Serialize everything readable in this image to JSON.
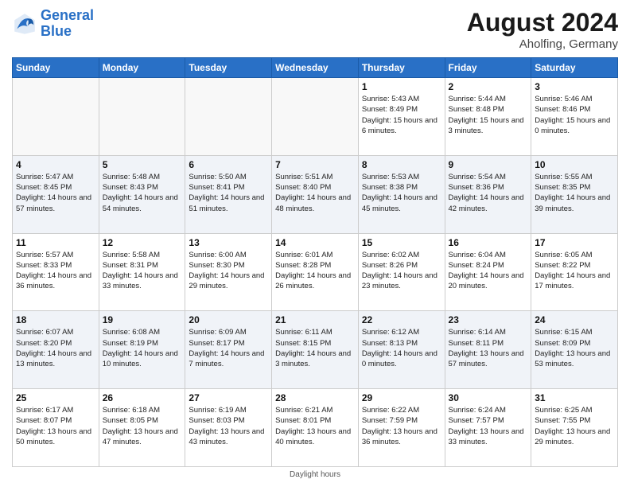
{
  "header": {
    "logo_line1": "General",
    "logo_line2": "Blue",
    "month_year": "August 2024",
    "location": "Aholfing, Germany"
  },
  "footer": {
    "note": "Daylight hours"
  },
  "days_of_week": [
    "Sunday",
    "Monday",
    "Tuesday",
    "Wednesday",
    "Thursday",
    "Friday",
    "Saturday"
  ],
  "weeks": [
    [
      {
        "day": "",
        "sunrise": "",
        "sunset": "",
        "daylight": ""
      },
      {
        "day": "",
        "sunrise": "",
        "sunset": "",
        "daylight": ""
      },
      {
        "day": "",
        "sunrise": "",
        "sunset": "",
        "daylight": ""
      },
      {
        "day": "",
        "sunrise": "",
        "sunset": "",
        "daylight": ""
      },
      {
        "day": "1",
        "sunrise": "Sunrise: 5:43 AM",
        "sunset": "Sunset: 8:49 PM",
        "daylight": "Daylight: 15 hours and 6 minutes."
      },
      {
        "day": "2",
        "sunrise": "Sunrise: 5:44 AM",
        "sunset": "Sunset: 8:48 PM",
        "daylight": "Daylight: 15 hours and 3 minutes."
      },
      {
        "day": "3",
        "sunrise": "Sunrise: 5:46 AM",
        "sunset": "Sunset: 8:46 PM",
        "daylight": "Daylight: 15 hours and 0 minutes."
      }
    ],
    [
      {
        "day": "4",
        "sunrise": "Sunrise: 5:47 AM",
        "sunset": "Sunset: 8:45 PM",
        "daylight": "Daylight: 14 hours and 57 minutes."
      },
      {
        "day": "5",
        "sunrise": "Sunrise: 5:48 AM",
        "sunset": "Sunset: 8:43 PM",
        "daylight": "Daylight: 14 hours and 54 minutes."
      },
      {
        "day": "6",
        "sunrise": "Sunrise: 5:50 AM",
        "sunset": "Sunset: 8:41 PM",
        "daylight": "Daylight: 14 hours and 51 minutes."
      },
      {
        "day": "7",
        "sunrise": "Sunrise: 5:51 AM",
        "sunset": "Sunset: 8:40 PM",
        "daylight": "Daylight: 14 hours and 48 minutes."
      },
      {
        "day": "8",
        "sunrise": "Sunrise: 5:53 AM",
        "sunset": "Sunset: 8:38 PM",
        "daylight": "Daylight: 14 hours and 45 minutes."
      },
      {
        "day": "9",
        "sunrise": "Sunrise: 5:54 AM",
        "sunset": "Sunset: 8:36 PM",
        "daylight": "Daylight: 14 hours and 42 minutes."
      },
      {
        "day": "10",
        "sunrise": "Sunrise: 5:55 AM",
        "sunset": "Sunset: 8:35 PM",
        "daylight": "Daylight: 14 hours and 39 minutes."
      }
    ],
    [
      {
        "day": "11",
        "sunrise": "Sunrise: 5:57 AM",
        "sunset": "Sunset: 8:33 PM",
        "daylight": "Daylight: 14 hours and 36 minutes."
      },
      {
        "day": "12",
        "sunrise": "Sunrise: 5:58 AM",
        "sunset": "Sunset: 8:31 PM",
        "daylight": "Daylight: 14 hours and 33 minutes."
      },
      {
        "day": "13",
        "sunrise": "Sunrise: 6:00 AM",
        "sunset": "Sunset: 8:30 PM",
        "daylight": "Daylight: 14 hours and 29 minutes."
      },
      {
        "day": "14",
        "sunrise": "Sunrise: 6:01 AM",
        "sunset": "Sunset: 8:28 PM",
        "daylight": "Daylight: 14 hours and 26 minutes."
      },
      {
        "day": "15",
        "sunrise": "Sunrise: 6:02 AM",
        "sunset": "Sunset: 8:26 PM",
        "daylight": "Daylight: 14 hours and 23 minutes."
      },
      {
        "day": "16",
        "sunrise": "Sunrise: 6:04 AM",
        "sunset": "Sunset: 8:24 PM",
        "daylight": "Daylight: 14 hours and 20 minutes."
      },
      {
        "day": "17",
        "sunrise": "Sunrise: 6:05 AM",
        "sunset": "Sunset: 8:22 PM",
        "daylight": "Daylight: 14 hours and 17 minutes."
      }
    ],
    [
      {
        "day": "18",
        "sunrise": "Sunrise: 6:07 AM",
        "sunset": "Sunset: 8:20 PM",
        "daylight": "Daylight: 14 hours and 13 minutes."
      },
      {
        "day": "19",
        "sunrise": "Sunrise: 6:08 AM",
        "sunset": "Sunset: 8:19 PM",
        "daylight": "Daylight: 14 hours and 10 minutes."
      },
      {
        "day": "20",
        "sunrise": "Sunrise: 6:09 AM",
        "sunset": "Sunset: 8:17 PM",
        "daylight": "Daylight: 14 hours and 7 minutes."
      },
      {
        "day": "21",
        "sunrise": "Sunrise: 6:11 AM",
        "sunset": "Sunset: 8:15 PM",
        "daylight": "Daylight: 14 hours and 3 minutes."
      },
      {
        "day": "22",
        "sunrise": "Sunrise: 6:12 AM",
        "sunset": "Sunset: 8:13 PM",
        "daylight": "Daylight: 14 hours and 0 minutes."
      },
      {
        "day": "23",
        "sunrise": "Sunrise: 6:14 AM",
        "sunset": "Sunset: 8:11 PM",
        "daylight": "Daylight: 13 hours and 57 minutes."
      },
      {
        "day": "24",
        "sunrise": "Sunrise: 6:15 AM",
        "sunset": "Sunset: 8:09 PM",
        "daylight": "Daylight: 13 hours and 53 minutes."
      }
    ],
    [
      {
        "day": "25",
        "sunrise": "Sunrise: 6:17 AM",
        "sunset": "Sunset: 8:07 PM",
        "daylight": "Daylight: 13 hours and 50 minutes."
      },
      {
        "day": "26",
        "sunrise": "Sunrise: 6:18 AM",
        "sunset": "Sunset: 8:05 PM",
        "daylight": "Daylight: 13 hours and 47 minutes."
      },
      {
        "day": "27",
        "sunrise": "Sunrise: 6:19 AM",
        "sunset": "Sunset: 8:03 PM",
        "daylight": "Daylight: 13 hours and 43 minutes."
      },
      {
        "day": "28",
        "sunrise": "Sunrise: 6:21 AM",
        "sunset": "Sunset: 8:01 PM",
        "daylight": "Daylight: 13 hours and 40 minutes."
      },
      {
        "day": "29",
        "sunrise": "Sunrise: 6:22 AM",
        "sunset": "Sunset: 7:59 PM",
        "daylight": "Daylight: 13 hours and 36 minutes."
      },
      {
        "day": "30",
        "sunrise": "Sunrise: 6:24 AM",
        "sunset": "Sunset: 7:57 PM",
        "daylight": "Daylight: 13 hours and 33 minutes."
      },
      {
        "day": "31",
        "sunrise": "Sunrise: 6:25 AM",
        "sunset": "Sunset: 7:55 PM",
        "daylight": "Daylight: 13 hours and 29 minutes."
      }
    ]
  ]
}
